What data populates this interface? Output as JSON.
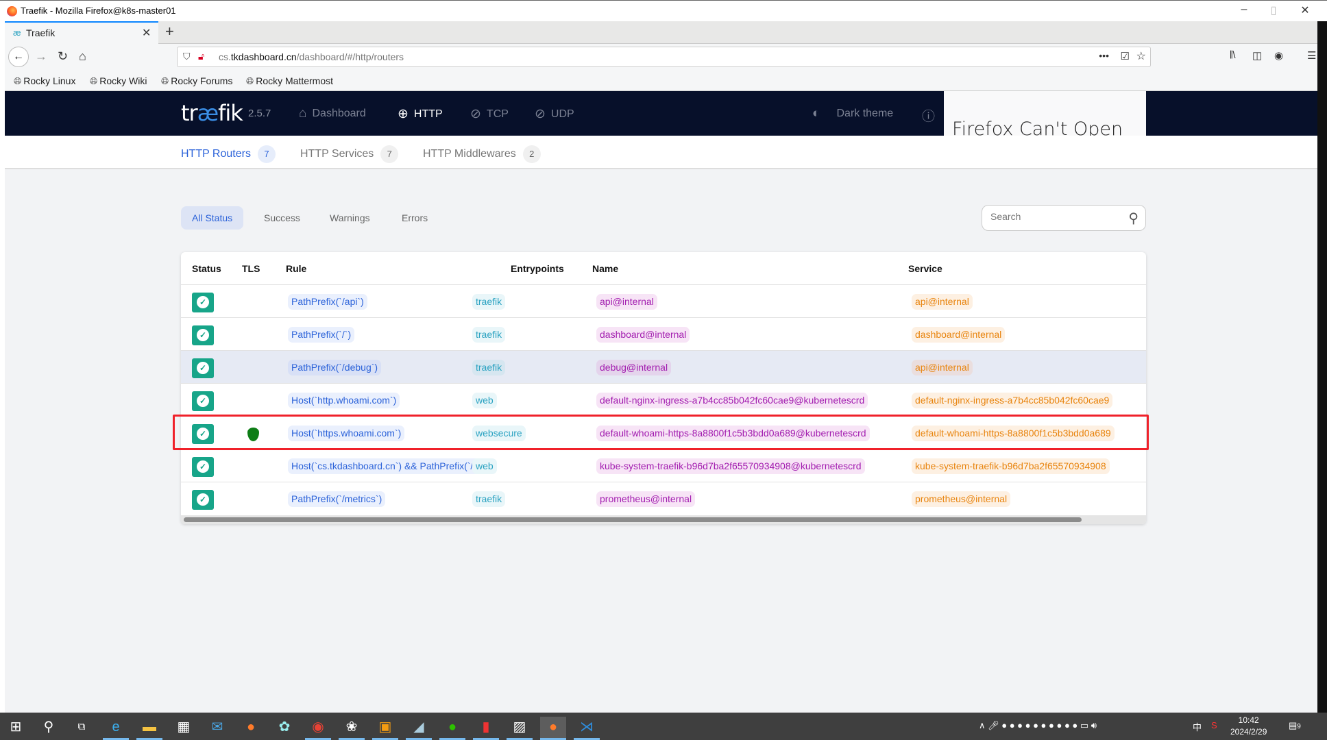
{
  "window": {
    "title": "Traefik - Mozilla Firefox@k8s-master01",
    "controls": [
      "minimize",
      "restore",
      "close"
    ]
  },
  "browser": {
    "tab": {
      "label": "Traefik",
      "icon": "traefik-icon"
    },
    "url": {
      "host_prefix": "cs.",
      "host": "tkdashboard.cn",
      "path": "/dashboard/#/http/routers"
    },
    "bookmarks": [
      {
        "label": "Rocky Linux"
      },
      {
        "label": "Rocky Wiki"
      },
      {
        "label": "Rocky Forums"
      },
      {
        "label": "Rocky Mattermost"
      }
    ],
    "popup_text": "Firefox Can't Open"
  },
  "app": {
    "logo": {
      "pre": "tr",
      "ae": "æ",
      "post": "fik"
    },
    "version": "2.5.7",
    "nav": [
      {
        "label": "Dashboard",
        "icon": "home-icon"
      },
      {
        "label": "HTTP",
        "icon": "globe-icon",
        "active": true
      },
      {
        "label": "TCP",
        "icon": "tcp-icon"
      },
      {
        "label": "UDP",
        "icon": "udp-icon"
      }
    ],
    "theme_toggle": "Dark theme",
    "subtabs": [
      {
        "label": "HTTP Routers",
        "count": "7",
        "active": true
      },
      {
        "label": "HTTP Services",
        "count": "7"
      },
      {
        "label": "HTTP Middlewares",
        "count": "2"
      }
    ],
    "filters": [
      {
        "label": "All Status",
        "active": true
      },
      {
        "label": "Success"
      },
      {
        "label": "Warnings"
      },
      {
        "label": "Errors"
      }
    ],
    "search": {
      "placeholder": "Search",
      "value": ""
    },
    "table": {
      "columns": [
        "Status",
        "TLS",
        "Rule",
        "Entrypoints",
        "Name",
        "Service"
      ],
      "rows": [
        {
          "status": "success",
          "tls": false,
          "rule": "PathPrefix(`/api`)",
          "entrypoint": "traefik",
          "name": "api@internal",
          "service": "api@internal"
        },
        {
          "status": "success",
          "tls": false,
          "rule": "PathPrefix(`/`)",
          "entrypoint": "traefik",
          "name": "dashboard@internal",
          "service": "dashboard@internal"
        },
        {
          "status": "success",
          "tls": false,
          "rule": "PathPrefix(`/debug`)",
          "entrypoint": "traefik",
          "name": "debug@internal",
          "service": "api@internal",
          "hovered": true
        },
        {
          "status": "success",
          "tls": false,
          "rule": "Host(`http.whoami.com`)",
          "entrypoint": "web",
          "name": "default-nginx-ingress-a7b4cc85b042fc60cae9@kubernetescrd",
          "service": "default-nginx-ingress-a7b4cc85b042fc60cae9"
        },
        {
          "status": "success",
          "tls": true,
          "rule": "Host(`https.whoami.com`)",
          "entrypoint": "websecure",
          "name": "default-whoami-https-8a8800f1c5b3bdd0a689@kubernetescrd",
          "service": "default-whoami-https-8a8800f1c5b3bdd0a689",
          "highlighted": true
        },
        {
          "status": "success",
          "tls": false,
          "rule": "Host(`cs.tkdashboard.cn`) && PathPrefix(`/`)",
          "entrypoint": "web",
          "name": "kube-system-traefik-b96d7ba2f65570934908@kubernetescrd",
          "service": "kube-system-traefik-b96d7ba2f65570934908"
        },
        {
          "status": "success",
          "tls": false,
          "rule": "PathPrefix(`/metrics`)",
          "entrypoint": "traefik",
          "name": "prometheus@internal",
          "service": "prometheus@internal"
        }
      ]
    },
    "colors": {
      "header_bg": "#07102a",
      "accent": "#2b62d9",
      "success": "#17a589",
      "entrypoint": "#2aa2c1",
      "name": "#a21caf",
      "service": "#e8840e",
      "highlight_border": "#f0212a"
    }
  },
  "taskbar": {
    "time": "10:42",
    "date": "2024/2/29",
    "ime": "中",
    "notifications": "9"
  }
}
